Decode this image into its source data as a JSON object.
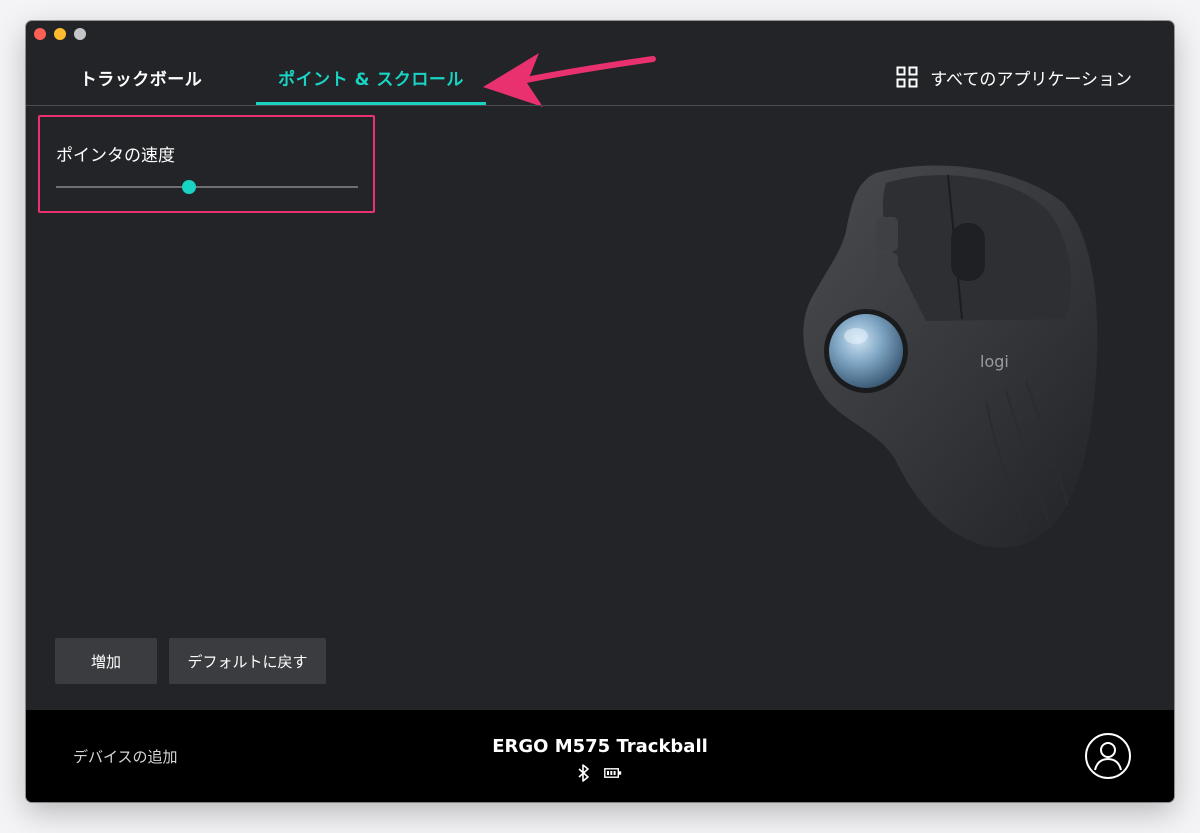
{
  "tabs": {
    "trackball": "トラックボール",
    "point_scroll": "ポイント & スクロール",
    "active": "point_scroll"
  },
  "all_apps": {
    "label": "すべてのアプリケーション",
    "icon": "grid-icon"
  },
  "pointer_speed": {
    "label": "ポインタの速度",
    "value": 0.44
  },
  "buttons": {
    "increase": "増加",
    "reset": "デフォルトに戻す"
  },
  "footer": {
    "add_device": "デバイスの追加",
    "device_name": "ERGO M575 Trackball",
    "status_icons": [
      "bluetooth-icon",
      "battery-icon"
    ],
    "account_icon": "account-icon"
  },
  "product_image": {
    "logo_text": "logi"
  },
  "colors": {
    "accent": "#19d4c4",
    "annotation": "#e8316e",
    "background": "#232427",
    "footer": "#000000"
  }
}
